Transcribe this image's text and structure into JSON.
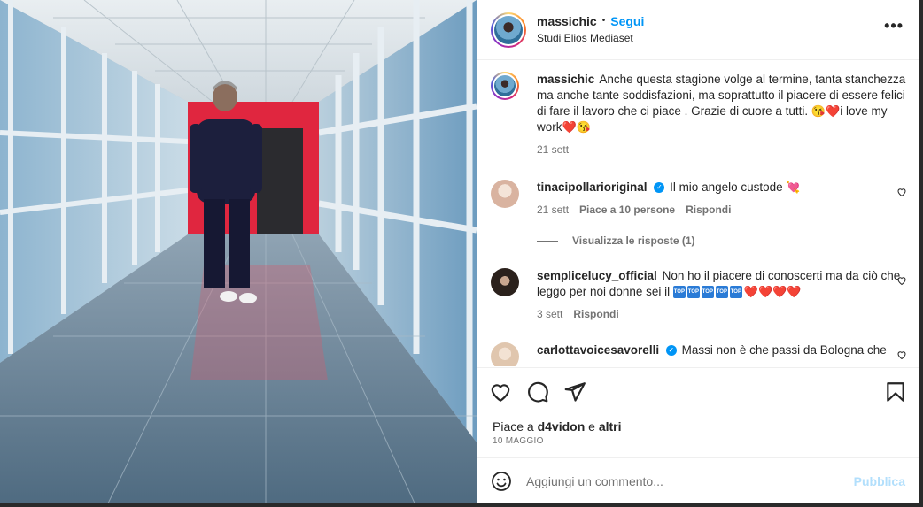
{
  "post": {
    "username": "massichic",
    "follow_label": "Segui",
    "separator": "•",
    "location": "Studi Elios Mediaset",
    "more_icon": "more-horizontal-icon"
  },
  "caption": {
    "username": "massichic",
    "text": "Anche questa stagione volge al termine, tanta stanchezza ma anche tante soddisfazioni, ma soprattutto il piacere di essere felici di fare il lavoro che ci piace . Grazie di cuore a tutti. ",
    "emojis_1": "😘❤️",
    "text_tail": "i love my work",
    "emojis_2": "❤️😘",
    "time": "21 sett"
  },
  "comments": [
    {
      "username": "tinacipollarioriginal",
      "verified": true,
      "text": "Il mio angelo custode ",
      "emoji": "💘",
      "time": "21 sett",
      "likes": "Piace a 10 persone",
      "reply": "Rispondi",
      "avatar_color": "#e9c9b8"
    },
    {
      "username": "semplicelucy_official",
      "verified": false,
      "text": "Non ho il piacere di conoscerti ma da ciò che leggo per noi donne sei il ",
      "top_badge": "TOP",
      "top_count": 5,
      "emoji": "❤️❤️❤️❤️",
      "time": "3 sett",
      "reply": "Rispondi",
      "avatar_color": "#3a2b22"
    },
    {
      "username": "carlottavoicesavorelli",
      "verified": true,
      "text": "Massi non è che passi da Bologna che",
      "avatar_color": "#e8d7c6"
    }
  ],
  "view_replies": "Visualizza le risposte (1)",
  "actions": {
    "like_icon": "heart-icon",
    "comment_icon": "comment-icon",
    "share_icon": "send-icon",
    "save_icon": "bookmark-icon"
  },
  "likes_line": {
    "prefix": "Piace a ",
    "user": "d4vidon",
    "middle": " e ",
    "rest": "altri"
  },
  "post_date": "10 MAGGIO",
  "add_comment": {
    "placeholder": "Aggiungi un commento...",
    "publish": "Pubblica",
    "emoji_icon": "smiley-icon"
  },
  "colors": {
    "accent": "#0095f6",
    "publish_disabled": "#b2dffc",
    "secondary_text": "#737373"
  }
}
